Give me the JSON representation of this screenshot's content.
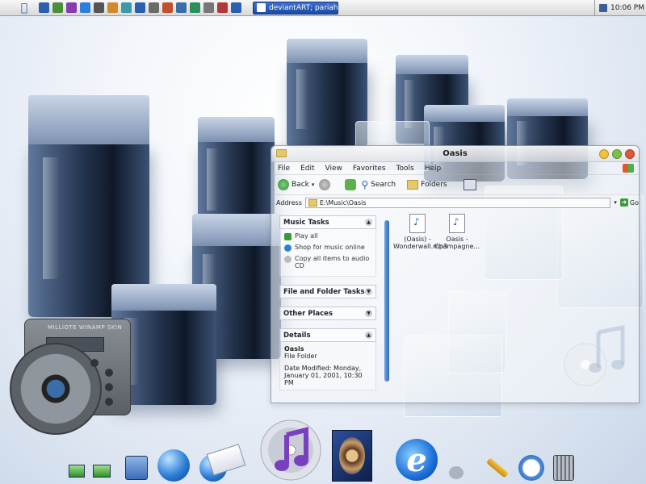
{
  "topbar": {
    "quicklaunch_icons": [
      "app-icon",
      "app-icon",
      "app-icon",
      "app-icon",
      "app-icon",
      "app-icon",
      "app-icon",
      "app-icon",
      "app-icon",
      "app-icon",
      "app-icon",
      "app-icon",
      "app-icon",
      "app-icon",
      "app-icon"
    ],
    "active_task": "deviantART; pariahde...",
    "clock": "10:06 PM"
  },
  "window": {
    "title": "Oasis",
    "menu": [
      "File",
      "Edit",
      "View",
      "Favorites",
      "Tools",
      "Help"
    ],
    "toolbar": {
      "back": "Back",
      "search": "Search",
      "folders": "Folders"
    },
    "address": {
      "label": "Address",
      "value": "E:\\Music\\Oasis",
      "go": "Go"
    },
    "music_tasks": {
      "title": "Music Tasks",
      "items": [
        "Play all",
        "Shop for music online",
        "Copy all items to audio CD"
      ]
    },
    "file_folder_tasks": {
      "title": "File and Folder Tasks"
    },
    "other_places": {
      "title": "Other Places"
    },
    "details": {
      "title": "Details",
      "name": "Oasis",
      "type": "File Folder",
      "modified": "Date Modified: Monday, January 01, 2001, 10:30 PM"
    },
    "files": [
      {
        "name": "(Oasis) - Wonderwall.mp3"
      },
      {
        "name": "Oasis - Champagne..."
      }
    ]
  },
  "player": {
    "label": "MILLIOTE WINAMP SKIN"
  },
  "dock": {
    "items": [
      "network-icon",
      "network-icon",
      "folder-icon",
      "globe-icon",
      "globe-icon",
      "mail-icon",
      "itunes-icon",
      "photoshop-icon",
      "internet-explorer-icon",
      "recycle-icon",
      "tools-icon",
      "clock-icon",
      "trash-icon"
    ]
  },
  "colors": {
    "accent": "#1b4aa7",
    "cube": "#24344e"
  }
}
